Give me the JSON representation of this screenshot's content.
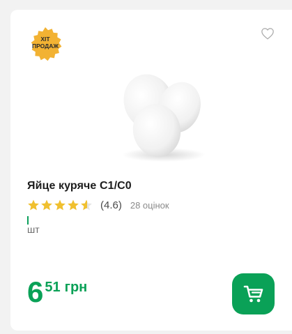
{
  "product": {
    "badge": [
      "ХІТ",
      "ПРОДАЖ"
    ],
    "title": "Яйце куряче С1/С0",
    "rating_value": "(4.6)",
    "rating": 4.6,
    "rating_count": "28 оцінок",
    "unit": "шт",
    "price_int": "6",
    "price_frac": "51",
    "currency": "грн"
  },
  "colors": {
    "accent": "#0aa157",
    "badge": "#f2b233",
    "star": "#f0c02f"
  },
  "icons": {
    "favorite": "heart-outline-icon",
    "cart": "shopping-cart-icon"
  }
}
